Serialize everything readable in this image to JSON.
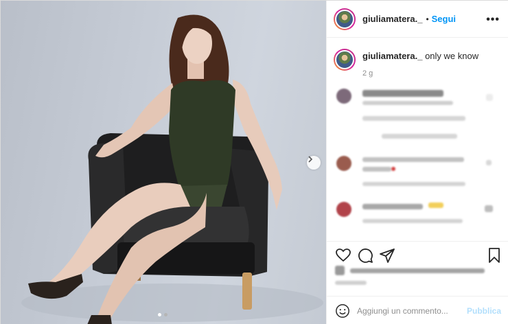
{
  "post": {
    "username": "giuliamatera._",
    "separator": "•",
    "follow_label": "Segui",
    "more_icon": "more-horizontal-icon",
    "caption_user": "giuliamatera._",
    "caption_text": "only we know",
    "time_ago": "2 g",
    "carousel": {
      "current": 1,
      "total": 2
    }
  },
  "actions": {
    "icons": [
      "heart-icon",
      "comment-icon",
      "share-icon",
      "bookmark-icon"
    ]
  },
  "composer": {
    "emoji_icon": "emoji-icon",
    "placeholder": "Aggiungi un commento...",
    "publish_label": "Pubblica"
  },
  "colors": {
    "follow": "#0095f6",
    "publish_disabled": "#b2dffc",
    "muted": "#8e8e8e"
  }
}
